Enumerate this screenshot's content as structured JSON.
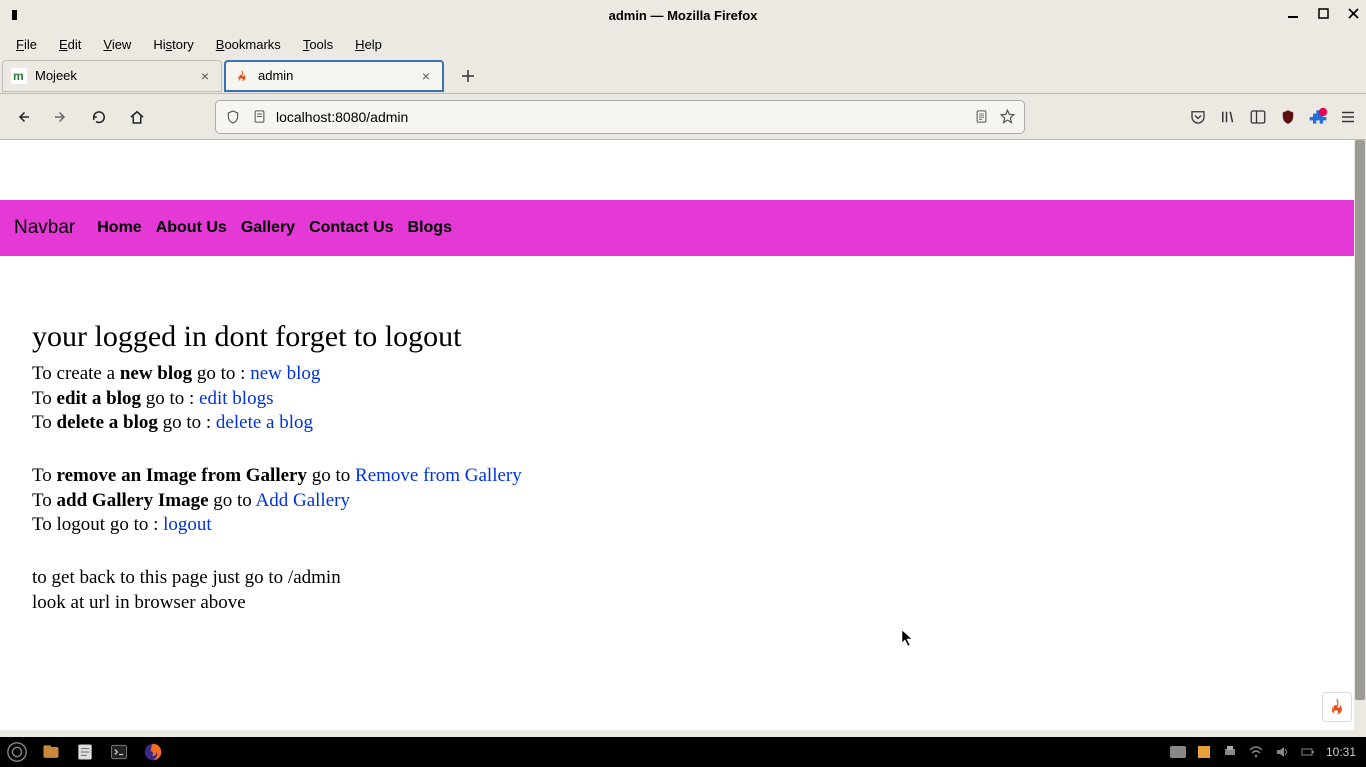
{
  "window": {
    "title": "admin — Mozilla Firefox",
    "minimize": "–",
    "maximize": "□",
    "close": "×"
  },
  "menubar": {
    "file": "File",
    "edit": "Edit",
    "view": "View",
    "history": "History",
    "bookmarks": "Bookmarks",
    "tools": "Tools",
    "help": "Help"
  },
  "tabs": {
    "mojeek": "Mojeek",
    "admin": "admin",
    "newtab_plus": "+"
  },
  "toolbar": {
    "url": "localhost:8080/admin"
  },
  "page": {
    "nav": {
      "brand": "Navbar",
      "home": "Home",
      "about": "About Us",
      "gallery": "Gallery",
      "contact": "Contact Us",
      "blogs": "Blogs"
    },
    "heading": "your logged in dont forget to logout",
    "line1_pre": "To create a ",
    "line1_bold": "new blog",
    "line1_mid": " go to : ",
    "line1_link": "new blog",
    "line2_pre": "To ",
    "line2_bold": "edit a blog",
    "line2_mid": " go to : ",
    "line2_link": "edit blogs",
    "line3_pre": "To ",
    "line3_bold": "delete a blog",
    "line3_mid": " go to : ",
    "line3_link": "delete a blog",
    "line4_pre": "To ",
    "line4_bold": "remove an Image from Gallery",
    "line4_mid": " go to ",
    "line4_link": "Remove from Gallery",
    "line5_pre": "To ",
    "line5_bold": "add Gallery Image",
    "line5_mid": " go to ",
    "line5_link": "Add Gallery",
    "line6_pre": "To logout go to : ",
    "line6_link": "logout",
    "line7": "to get back to this page just go to /admin",
    "line8": "look at url in browser above"
  },
  "taskbar": {
    "clock": "10:31"
  }
}
